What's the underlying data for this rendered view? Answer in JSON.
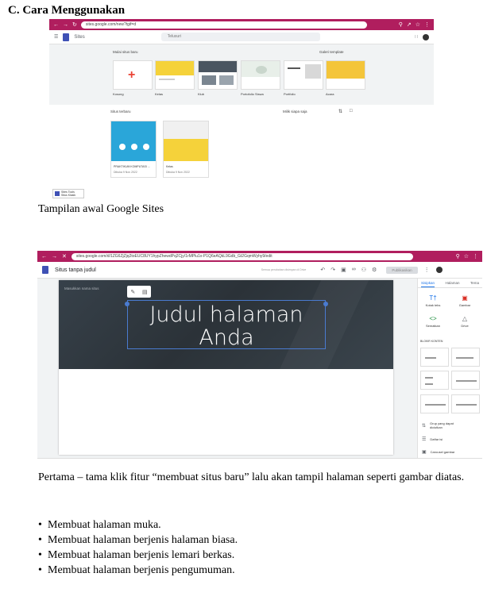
{
  "heading": "C.  Cara Menggunakan",
  "screenshot1": {
    "url": "sites.google.com/new?tgif=d",
    "app_name": "Sites",
    "search_placeholder": "Telusuri",
    "start_label": "Mulai situs baru",
    "gallery_label": "Galeri template",
    "templates": [
      {
        "name": "Kosong",
        "color": "#ffffff"
      },
      {
        "name": "Kelas",
        "color": "#f5d23a"
      },
      {
        "name": "Klub",
        "color": "#4a5560"
      },
      {
        "name": "Portofolio Siswa",
        "color": "#e8efe9"
      },
      {
        "name": "Portfolio",
        "color": "#f7f7f7"
      },
      {
        "name": "Acara",
        "color": "#f4c53a"
      }
    ],
    "recent_label": "Situs terbaru",
    "owner_filter": "Milik siapa saja",
    "recent_sites": [
      {
        "name": "PRAKTIKUM KOMPUTASI ...",
        "meta": "Dibuka 9 Nov 2022",
        "color": "#2aa6d9"
      },
      {
        "name": "Kelas",
        "meta": "Dibuka 9 Nov 2022",
        "color": "#f5d23a"
      }
    ]
  },
  "small_tag": {
    "line1": "Sites Tools",
    "line2": "Situs Klasik"
  },
  "caption1": "Tampilan awal  Google Sites",
  "screenshot2": {
    "url": "sites.google.com/d/1ZG6ZjZjq2toEUC8UY1hypZhewdPq2Cjy/1rMPlu1x-P1Q6eAQkL9Gdb_Gt2GqmWyhy9/edit",
    "doc_title": "Situs tanpa judul",
    "saved_status": "Semua perubahan disimpan di Drive",
    "publish_label": "Publikasikan",
    "site_name_placeholder": "Masukkan nama situs",
    "title_line1": "Judul halaman",
    "title_line2": "Anda",
    "tabs": [
      "Sisipkan",
      "Halaman",
      "Tema"
    ],
    "insert_items": [
      "Kotak teks",
      "Gambar",
      "Sematkan",
      "Drive"
    ],
    "layout_header": "BLOKIR KONTEN",
    "side_items": [
      "Grup yang dapat diciutkan",
      "Daftar isi",
      "Carousel gambar"
    ]
  },
  "paragraph": "Pertama – tama  klik fitur “membuat situs baru” lalu akan tampil halaman seperti gambar diatas.",
  "bullets": [
    "Membuat halaman muka.",
    "Membuat halaman berjenis halaman biasa.",
    "Membuat halaman berjenis lemari berkas.",
    "Membuat halaman berjenis pengumuman."
  ],
  "colors": {
    "browser_bar": "#b01e5e",
    "accent_blue": "#1a73e8",
    "hero": "#2f373e"
  },
  "icons": [
    "back-arrow-icon",
    "forward-arrow-icon",
    "reload-icon",
    "menu-icon",
    "search-icon",
    "grid-icon",
    "plus-icon",
    "pencil-icon",
    "trash-icon",
    "undo-icon",
    "redo-icon",
    "preview-icon",
    "link-icon",
    "share-icon",
    "settings-icon",
    "more-icon"
  ]
}
